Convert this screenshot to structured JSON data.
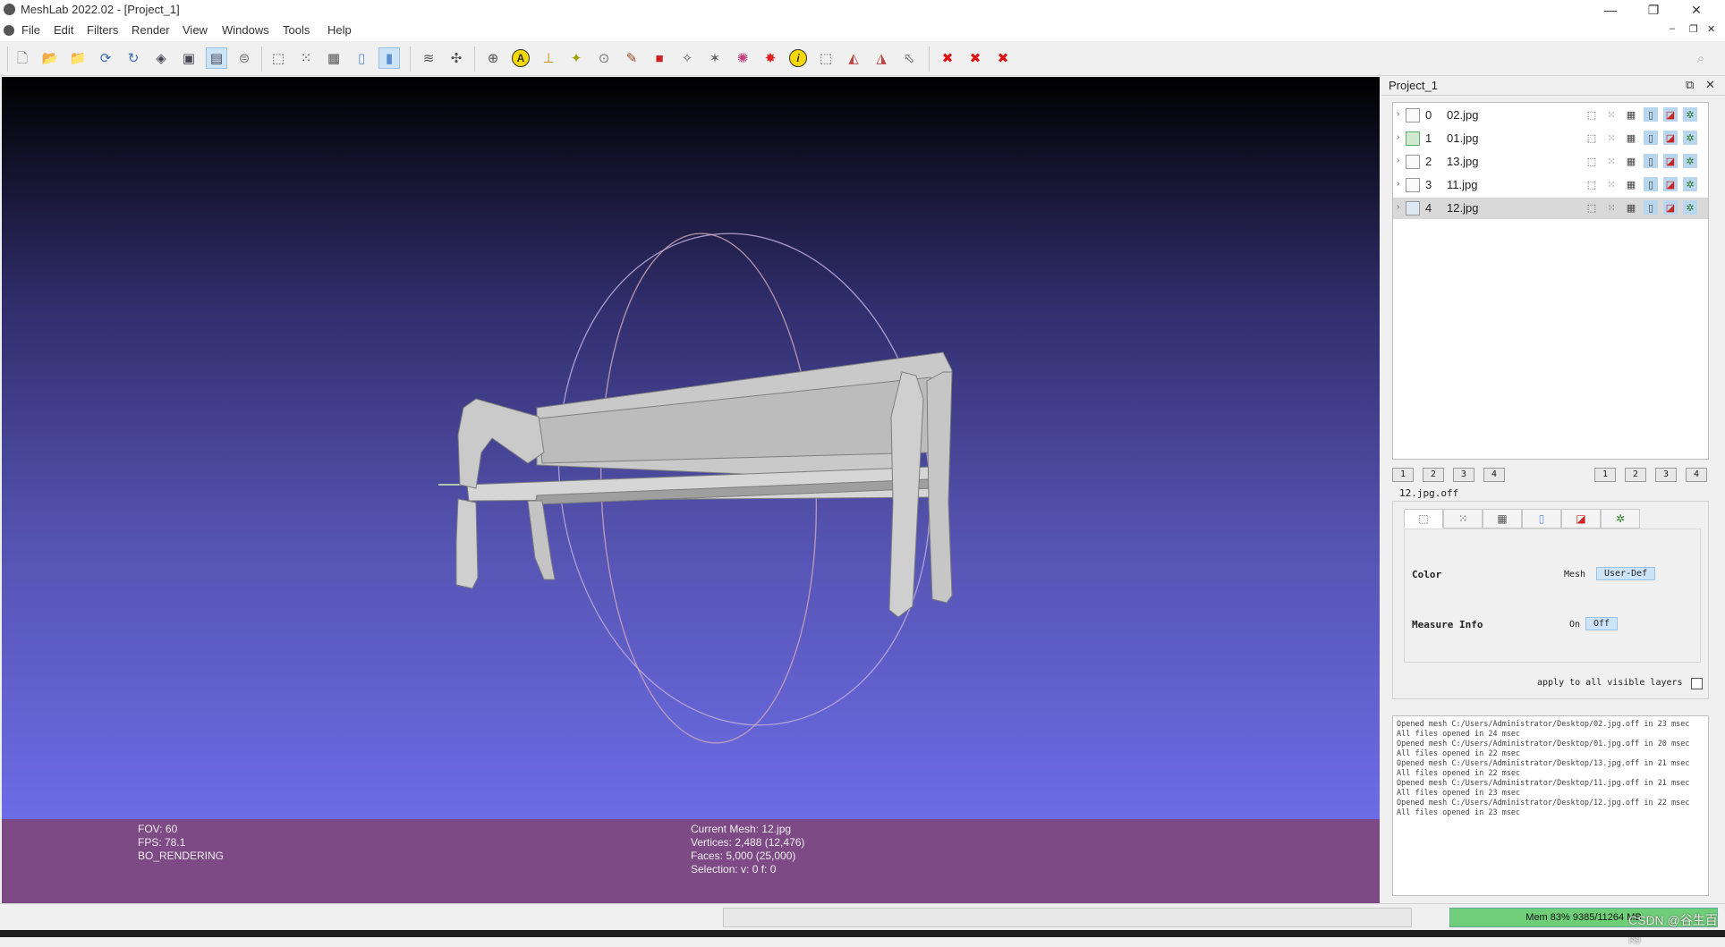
{
  "window": {
    "title": "MeshLab 2022.02 - [Project_1]",
    "minimize_glyph": "—",
    "restore_glyph": "❐",
    "close_glyph": "✕",
    "mdi_minimize_glyph": "–",
    "mdi_restore_glyph": "❐",
    "mdi_close_glyph": "✕"
  },
  "menu": [
    "File",
    "Edit",
    "Filters",
    "Render",
    "View",
    "Windows",
    "Tools",
    "Help"
  ],
  "toolbar": {
    "icons": [
      "new-project-icon",
      "open-project-icon",
      "open-mesh-icon",
      "reload-icon",
      "reload-all-icon",
      "save-icon",
      "snapshot-icon",
      "layers-icon",
      "raster-icon",
      "bounding-box-icon",
      "points-icon",
      "wireframe-icon",
      "flat-icon",
      "smooth-icon",
      "copy-layer-icon",
      "axes-icon",
      "trackball-icon",
      "annotation-icon",
      "align-icon",
      "manipulator-icon",
      "color-paint-icon",
      "paint-icon",
      "point-picker-icon",
      "mesh-select-icon",
      "vertex-select-icon",
      "georef-icon",
      "info-icon",
      "select-faces-icon",
      "select-vertices-icon",
      "select-connected-icon",
      "delete-faces-icon",
      "delete-vertices-icon",
      "delete-all-icon"
    ],
    "search_icon": "search-icon"
  },
  "viewport": {
    "stats_left": [
      "FOV: 60",
      "FPS:   78.1",
      "BO_RENDERING"
    ],
    "stats_right": [
      "Current Mesh: 12.jpg",
      "Vertices: 2,488    (12,476)",
      "Faces: 5,000    (25,000)",
      "Selection: v: 0 f: 0"
    ]
  },
  "project_panel": {
    "title": "Project_1",
    "float_glyph": "⧉",
    "close_glyph": "✕",
    "layers": [
      {
        "index": "0",
        "name": "02.jpg",
        "selected": false,
        "visible_green": false
      },
      {
        "index": "1",
        "name": "01.jpg",
        "selected": false,
        "visible_green": true
      },
      {
        "index": "2",
        "name": "13.jpg",
        "selected": false,
        "visible_green": false
      },
      {
        "index": "3",
        "name": "11.jpg",
        "selected": false,
        "visible_green": false
      },
      {
        "index": "4",
        "name": "12.jpg",
        "selected": true,
        "visible_green": false
      }
    ],
    "view_buttons_left": [
      "1",
      "2",
      "3",
      "4"
    ],
    "view_buttons_right": [
      "1",
      "2",
      "3",
      "4"
    ],
    "mesh_file": "12.jpg.off",
    "properties": {
      "color_label": "Color",
      "color_option": "Mesh",
      "color_value": "User-Def",
      "measure_label": "Measure Info",
      "measure_on": "On",
      "measure_off": "Off"
    },
    "apply_all": "apply to all visible layers"
  },
  "log": [
    "Opened mesh C:/Users/Administrator/Desktop/02.jpg.off in 23 msec",
    "All files opened in 24 msec",
    "Opened mesh C:/Users/Administrator/Desktop/01.jpg.off in 20 msec",
    "All files opened in 22 msec",
    "Opened mesh C:/Users/Administrator/Desktop/13.jpg.off in 21 msec",
    "All files opened in 22 msec",
    "Opened mesh C:/Users/Administrator/Desktop/11.jpg.off in 21 msec",
    "All files opened in 23 msec",
    "Opened mesh C:/Users/Administrator/Desktop/12.jpg.off in 22 msec",
    "All files opened in 23 msec"
  ],
  "status": {
    "mem": "Mem 83% 9385/11264 MB",
    "watermark": "CSDN @谷生百雨"
  },
  "colors": {
    "viewport_top": "#000000",
    "viewport_bottom": "#6c6ce6",
    "infobar": "#7e4a86",
    "mem_bar": "#6fcf78"
  }
}
